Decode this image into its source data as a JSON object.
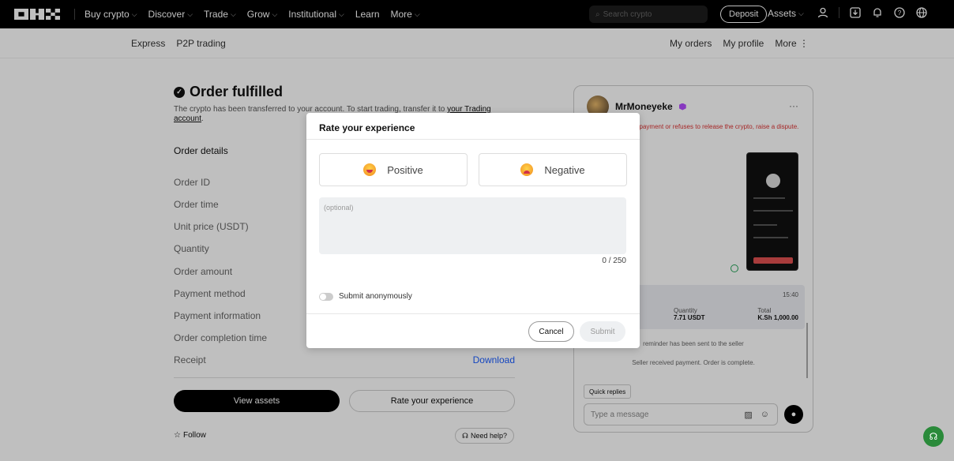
{
  "topbar": {
    "nav": [
      {
        "label": "Buy crypto",
        "has_chevron": true
      },
      {
        "label": "Discover",
        "has_chevron": true
      },
      {
        "label": "Trade",
        "has_chevron": true
      },
      {
        "label": "Grow",
        "has_chevron": true
      },
      {
        "label": "Institutional",
        "has_chevron": true
      },
      {
        "label": "Learn",
        "has_chevron": false
      },
      {
        "label": "More",
        "has_chevron": true
      }
    ],
    "search_placeholder": "Search crypto",
    "deposit_label": "Deposit",
    "assets_label": "Assets"
  },
  "subnav": {
    "left": [
      "Express",
      "P2P trading"
    ],
    "right": [
      "My orders",
      "My profile",
      "More ⋮"
    ]
  },
  "order": {
    "title": "Order fulfilled",
    "subtitle_pre": "The crypto has been transferred to your account. To start trading, transfer it to ",
    "subtitle_link": "your Trading account",
    "subtitle_post": ".",
    "details_heading": "Order details",
    "rows": [
      "Order ID",
      "Order time",
      "Unit price (USDT)",
      "Quantity",
      "Order amount",
      "Payment method",
      "Payment information",
      "Order completion time",
      "Receipt"
    ],
    "receipt_link": "Download",
    "view_assets_label": "View assets",
    "rate_label": "Rate your experience",
    "follow_label": "Follow",
    "need_help_label": "Need help?"
  },
  "chat": {
    "username": "MrMoneyeke",
    "warning": "cel the order after payment or refuses to release the crypto, raise a dispute.",
    "card_time": "15:40",
    "quantity_label": "Quantity",
    "quantity_value": "7.71 USDT",
    "total_label": "Total",
    "total_value": "K.Sh 1,000.00",
    "system_msg_1": "reminder has been sent to the seller",
    "system_msg_2": "Seller received payment. Order is complete.",
    "quick_replies_label": "Quick replies",
    "input_placeholder": "Type a message"
  },
  "modal": {
    "title": "Rate your experience",
    "positive_label": "Positive",
    "negative_label": "Negative",
    "textarea_placeholder": "(optional)",
    "counter": "0 / 250",
    "anonymous_label": "Submit anonymously",
    "cancel_label": "Cancel",
    "submit_label": "Submit"
  },
  "colors": {
    "link_blue": "#1a5cff",
    "warning_red": "#d33333",
    "support_green": "#2a8a3a"
  }
}
